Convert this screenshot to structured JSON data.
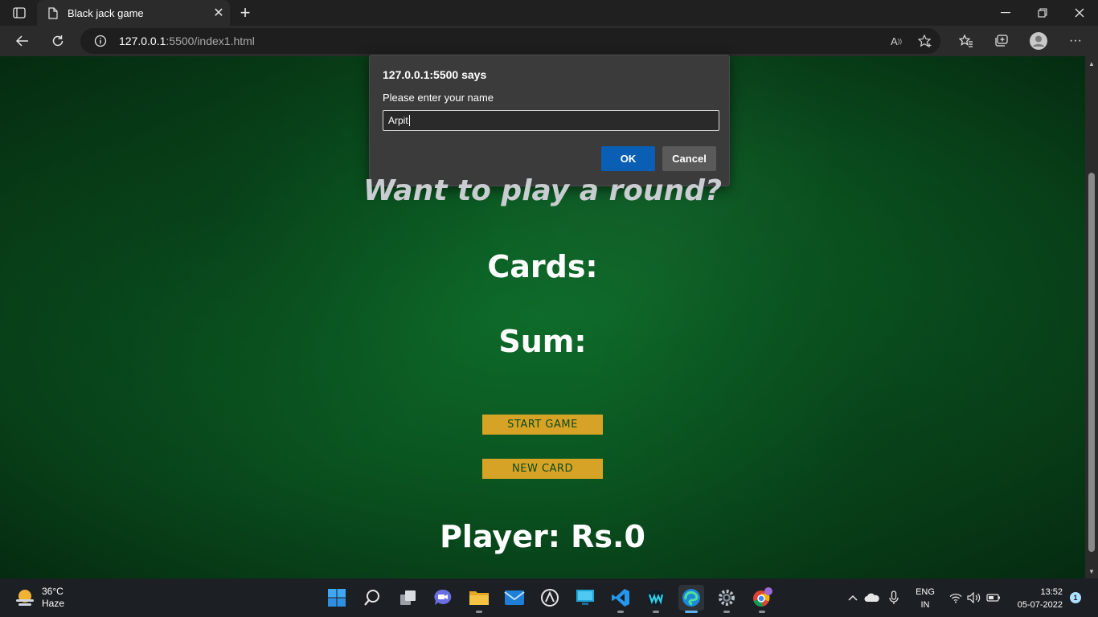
{
  "browser": {
    "tab_title": "Black jack game",
    "url_host": "127.0.0.1",
    "url_path": ":5500/index1.html"
  },
  "page": {
    "heading": "Want to play a round?",
    "cards_label": "Cards:",
    "sum_label": "Sum:",
    "start_button": "START GAME",
    "new_card_button": "NEW CARD",
    "player_label": "Player: Rs.0",
    "background_color": "#0a5420",
    "button_color": "#d7a326"
  },
  "dialog": {
    "origin": "127.0.0.1:5500 says",
    "message": "Please enter your name",
    "input_value": "Arpit",
    "ok_label": "OK",
    "cancel_label": "Cancel"
  },
  "taskbar": {
    "weather_temp": "36°C",
    "weather_desc": "Haze",
    "lang_line1": "ENG",
    "lang_line2": "IN",
    "time": "13:52",
    "date": "05-07-2022",
    "notification_count": "1"
  }
}
